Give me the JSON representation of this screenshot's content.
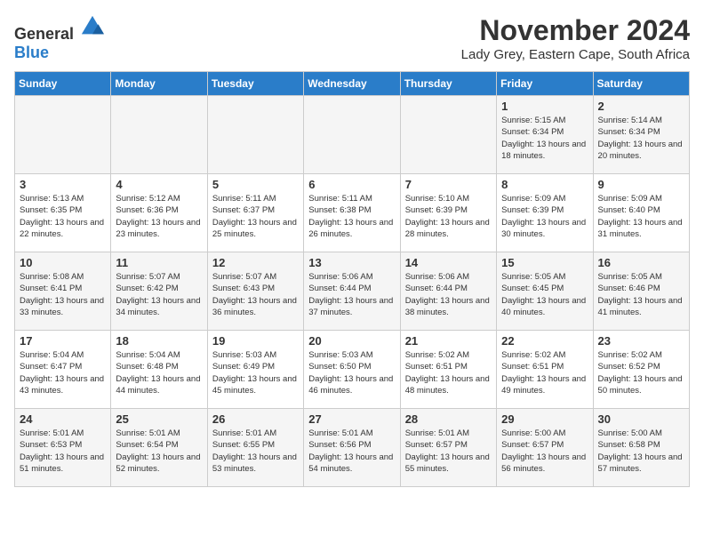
{
  "logo": {
    "general": "General",
    "blue": "Blue"
  },
  "title": "November 2024",
  "location": "Lady Grey, Eastern Cape, South Africa",
  "days_of_week": [
    "Sunday",
    "Monday",
    "Tuesday",
    "Wednesday",
    "Thursday",
    "Friday",
    "Saturday"
  ],
  "weeks": [
    [
      {
        "day": "",
        "info": ""
      },
      {
        "day": "",
        "info": ""
      },
      {
        "day": "",
        "info": ""
      },
      {
        "day": "",
        "info": ""
      },
      {
        "day": "",
        "info": ""
      },
      {
        "day": "1",
        "info": "Sunrise: 5:15 AM\nSunset: 6:34 PM\nDaylight: 13 hours and 18 minutes."
      },
      {
        "day": "2",
        "info": "Sunrise: 5:14 AM\nSunset: 6:34 PM\nDaylight: 13 hours and 20 minutes."
      }
    ],
    [
      {
        "day": "3",
        "info": "Sunrise: 5:13 AM\nSunset: 6:35 PM\nDaylight: 13 hours and 22 minutes."
      },
      {
        "day": "4",
        "info": "Sunrise: 5:12 AM\nSunset: 6:36 PM\nDaylight: 13 hours and 23 minutes."
      },
      {
        "day": "5",
        "info": "Sunrise: 5:11 AM\nSunset: 6:37 PM\nDaylight: 13 hours and 25 minutes."
      },
      {
        "day": "6",
        "info": "Sunrise: 5:11 AM\nSunset: 6:38 PM\nDaylight: 13 hours and 26 minutes."
      },
      {
        "day": "7",
        "info": "Sunrise: 5:10 AM\nSunset: 6:39 PM\nDaylight: 13 hours and 28 minutes."
      },
      {
        "day": "8",
        "info": "Sunrise: 5:09 AM\nSunset: 6:39 PM\nDaylight: 13 hours and 30 minutes."
      },
      {
        "day": "9",
        "info": "Sunrise: 5:09 AM\nSunset: 6:40 PM\nDaylight: 13 hours and 31 minutes."
      }
    ],
    [
      {
        "day": "10",
        "info": "Sunrise: 5:08 AM\nSunset: 6:41 PM\nDaylight: 13 hours and 33 minutes."
      },
      {
        "day": "11",
        "info": "Sunrise: 5:07 AM\nSunset: 6:42 PM\nDaylight: 13 hours and 34 minutes."
      },
      {
        "day": "12",
        "info": "Sunrise: 5:07 AM\nSunset: 6:43 PM\nDaylight: 13 hours and 36 minutes."
      },
      {
        "day": "13",
        "info": "Sunrise: 5:06 AM\nSunset: 6:44 PM\nDaylight: 13 hours and 37 minutes."
      },
      {
        "day": "14",
        "info": "Sunrise: 5:06 AM\nSunset: 6:44 PM\nDaylight: 13 hours and 38 minutes."
      },
      {
        "day": "15",
        "info": "Sunrise: 5:05 AM\nSunset: 6:45 PM\nDaylight: 13 hours and 40 minutes."
      },
      {
        "day": "16",
        "info": "Sunrise: 5:05 AM\nSunset: 6:46 PM\nDaylight: 13 hours and 41 minutes."
      }
    ],
    [
      {
        "day": "17",
        "info": "Sunrise: 5:04 AM\nSunset: 6:47 PM\nDaylight: 13 hours and 43 minutes."
      },
      {
        "day": "18",
        "info": "Sunrise: 5:04 AM\nSunset: 6:48 PM\nDaylight: 13 hours and 44 minutes."
      },
      {
        "day": "19",
        "info": "Sunrise: 5:03 AM\nSunset: 6:49 PM\nDaylight: 13 hours and 45 minutes."
      },
      {
        "day": "20",
        "info": "Sunrise: 5:03 AM\nSunset: 6:50 PM\nDaylight: 13 hours and 46 minutes."
      },
      {
        "day": "21",
        "info": "Sunrise: 5:02 AM\nSunset: 6:51 PM\nDaylight: 13 hours and 48 minutes."
      },
      {
        "day": "22",
        "info": "Sunrise: 5:02 AM\nSunset: 6:51 PM\nDaylight: 13 hours and 49 minutes."
      },
      {
        "day": "23",
        "info": "Sunrise: 5:02 AM\nSunset: 6:52 PM\nDaylight: 13 hours and 50 minutes."
      }
    ],
    [
      {
        "day": "24",
        "info": "Sunrise: 5:01 AM\nSunset: 6:53 PM\nDaylight: 13 hours and 51 minutes."
      },
      {
        "day": "25",
        "info": "Sunrise: 5:01 AM\nSunset: 6:54 PM\nDaylight: 13 hours and 52 minutes."
      },
      {
        "day": "26",
        "info": "Sunrise: 5:01 AM\nSunset: 6:55 PM\nDaylight: 13 hours and 53 minutes."
      },
      {
        "day": "27",
        "info": "Sunrise: 5:01 AM\nSunset: 6:56 PM\nDaylight: 13 hours and 54 minutes."
      },
      {
        "day": "28",
        "info": "Sunrise: 5:01 AM\nSunset: 6:57 PM\nDaylight: 13 hours and 55 minutes."
      },
      {
        "day": "29",
        "info": "Sunrise: 5:00 AM\nSunset: 6:57 PM\nDaylight: 13 hours and 56 minutes."
      },
      {
        "day": "30",
        "info": "Sunrise: 5:00 AM\nSunset: 6:58 PM\nDaylight: 13 hours and 57 minutes."
      }
    ]
  ]
}
